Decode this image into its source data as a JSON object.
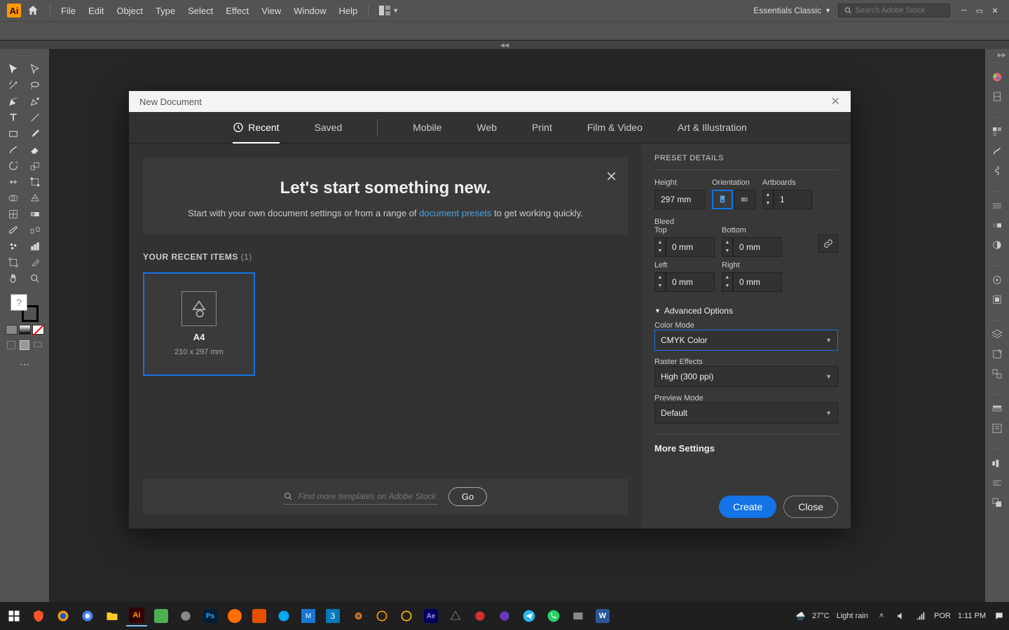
{
  "app": {
    "logo": "Ai",
    "workspace": "Essentials Classic",
    "search_placeholder": "Search Adobe Stock"
  },
  "menus": [
    "File",
    "Edit",
    "Object",
    "Type",
    "Select",
    "Effect",
    "View",
    "Window",
    "Help"
  ],
  "dialog": {
    "title": "New Document",
    "tabs": [
      "Recent",
      "Saved",
      "Mobile",
      "Web",
      "Print",
      "Film & Video",
      "Art & Illustration"
    ],
    "welcome": {
      "title": "Let's start something new.",
      "sub1": "Start with your own document settings or from a range of ",
      "link": "document presets",
      "sub2": " to get working quickly."
    },
    "recent_label": "YOUR RECENT ITEMS",
    "recent_count": "(1)",
    "preset": {
      "name": "A4",
      "dims": "210 x 297 mm"
    },
    "stock_placeholder": "Find more templates on Adobe Stock",
    "go": "Go",
    "preset_details": {
      "title": "PRESET DETAILS",
      "height_label": "Height",
      "height": "297 mm",
      "orientation_label": "Orientation",
      "artboards_label": "Artboards",
      "artboards": "1",
      "bleed_label": "Bleed",
      "top_label": "Top",
      "top": "0 mm",
      "bottom_label": "Bottom",
      "bottom": "0 mm",
      "left_label": "Left",
      "left": "0 mm",
      "right_label": "Right",
      "right": "0 mm",
      "adv_label": "Advanced Options",
      "colormode_label": "Color Mode",
      "colormode": "CMYK Color",
      "raster_label": "Raster Effects",
      "raster": "High (300 ppi)",
      "preview_label": "Preview Mode",
      "preview": "Default",
      "more": "More Settings",
      "create": "Create",
      "close": "Close"
    }
  },
  "taskbar": {
    "weather_temp": "27°C",
    "weather_text": "Light rain",
    "lang": "POR",
    "time": "1:11 PM"
  }
}
